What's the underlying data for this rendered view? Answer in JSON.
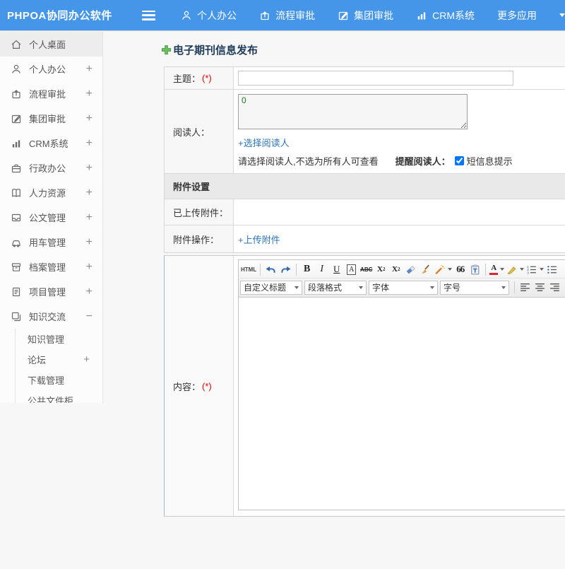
{
  "header": {
    "logo": "PHPOA协同办公软件",
    "nav": [
      {
        "label": "个人办公",
        "icon": "user-icon"
      },
      {
        "label": "流程审批",
        "icon": "workflow-icon"
      },
      {
        "label": "集团审批",
        "icon": "edit-icon"
      },
      {
        "label": "CRM系统",
        "icon": "bar-chart-icon"
      },
      {
        "label": "更多应用",
        "icon": "caret-down-icon"
      }
    ]
  },
  "sidebar": {
    "items": [
      {
        "label": "个人桌面",
        "icon": "home-icon",
        "expand": "",
        "active": true
      },
      {
        "label": "个人办公",
        "icon": "user-icon",
        "expand": "+"
      },
      {
        "label": "流程审批",
        "icon": "workflow-icon",
        "expand": "+"
      },
      {
        "label": "集团审批",
        "icon": "edit-icon",
        "expand": "+"
      },
      {
        "label": "CRM系统",
        "icon": "bar-chart-icon",
        "expand": "+"
      },
      {
        "label": "行政办公",
        "icon": "briefcase-icon",
        "expand": "+"
      },
      {
        "label": "人力资源",
        "icon": "book-icon",
        "expand": "+"
      },
      {
        "label": "公文管理",
        "icon": "inbox-icon",
        "expand": "+"
      },
      {
        "label": "用车管理",
        "icon": "car-icon",
        "expand": "+"
      },
      {
        "label": "档案管理",
        "icon": "archive-icon",
        "expand": "+"
      },
      {
        "label": "项目管理",
        "icon": "clipboard-icon",
        "expand": "+"
      },
      {
        "label": "知识交流",
        "icon": "chat-stack-icon",
        "expand": "−",
        "expanded": true
      }
    ],
    "knowledge_children": [
      {
        "label": "知识管理",
        "expand": ""
      },
      {
        "label": "论坛",
        "expand": "+"
      },
      {
        "label": "下载管理",
        "expand": ""
      },
      {
        "label": "公共文件柜",
        "expand": ""
      }
    ]
  },
  "main": {
    "page_title": "电子期刊信息发布",
    "form": {
      "subject_label": "主题：",
      "required_mark": "(*)",
      "subject_value": "",
      "readers_label": "阅读人：",
      "readers_value": "0",
      "select_readers_link": "+选择阅读人",
      "readers_hint": "请选择阅读人,不选为所有人可查看",
      "remind_label": "提醒阅读人：",
      "sms_checked": true,
      "sms_label": "短信息提示",
      "attachment_section_title": "附件设置",
      "uploaded_label": "已上传附件：",
      "uploaded_value": "",
      "attachment_op_label": "附件操作：",
      "upload_link": "+上传附件",
      "content_label": "内容："
    },
    "editor": {
      "html_label": "HTML",
      "bold_label": "B",
      "italic_label": "I",
      "underline_label": "U",
      "font_border_label": "A",
      "strike_label": "ABC",
      "sup_base": "X",
      "sup_mark": "2",
      "sub_base": "X",
      "sub_mark": "2",
      "quote_label": "66",
      "font_color_label": "A",
      "heading_dropdown": "自定义标题",
      "paragraph_dropdown": "段落格式",
      "font_dropdown": "字体",
      "fontsize_dropdown": "字号",
      "content_value": ""
    }
  },
  "colors": {
    "header_blue": "#4596e8",
    "link_blue": "#2d74b5",
    "title_navy": "#1f3b5a",
    "required_red": "#e60000",
    "reader_green": "#1e7d1e"
  }
}
